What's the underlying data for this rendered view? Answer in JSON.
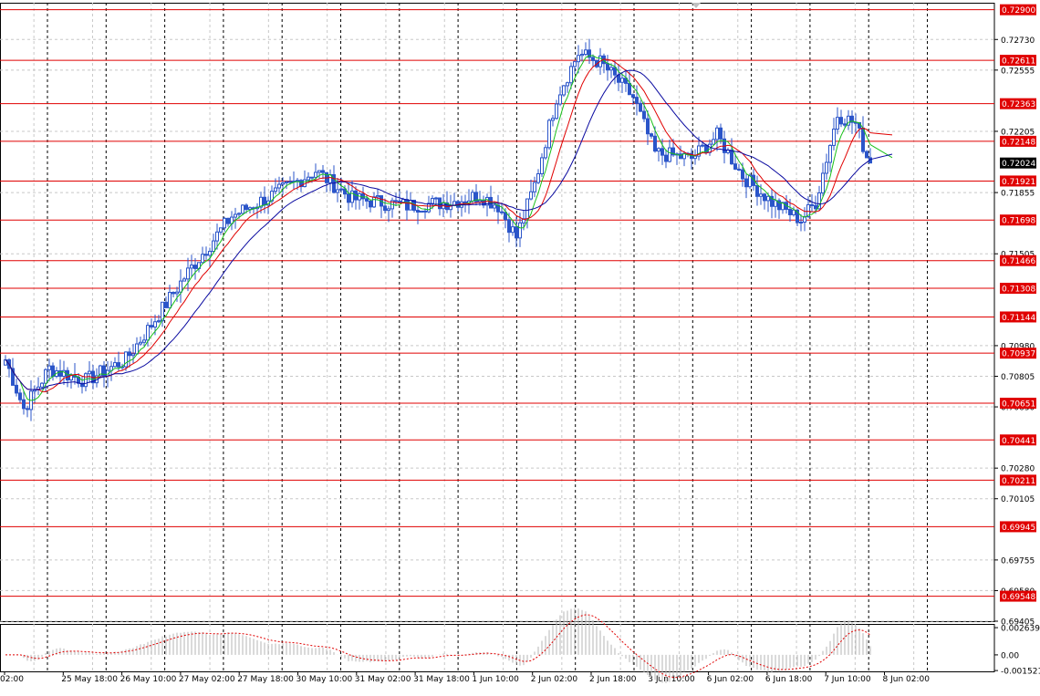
{
  "chart_data": [
    {
      "type": "candlestick",
      "title": "",
      "colors": {
        "candle": "#2b55c9",
        "ma_fast": "#19c019",
        "ma_mid": "#e00000",
        "ma_slow": "#0a0aa0",
        "level_line": "#e00000",
        "current_price_bg": "#000000"
      },
      "y_range": [
        0.69405,
        0.7294
      ],
      "grid": true,
      "price_ticks": [
        "0.72730",
        "0.72555",
        "0.72205",
        "0.71855",
        "0.71505",
        "0.70980",
        "0.70805",
        "0.70630",
        "0.70280",
        "0.70105",
        "0.69755",
        "0.69580",
        "0.69405"
      ],
      "levels": [
        "0.72900",
        "0.72611",
        "0.72363",
        "0.72148",
        "0.71921",
        "0.71698",
        "0.71466",
        "0.71308",
        "0.71144",
        "0.70937",
        "0.70651",
        "0.70441",
        "0.70211",
        "0.69945",
        "0.69548"
      ],
      "current_price": "0.72024",
      "time_labels": [
        "02:00",
        "25 May 18:00",
        "26 May 10:00",
        "27 May 02:00",
        "27 May 18:00",
        "30 May 10:00",
        "31 May 02:00",
        "31 May 18:00",
        "1 Jun 10:00",
        "2 Jun 02:00",
        "2 Jun 18:00",
        "3 Jun 10:00",
        "6 Jun 02:00",
        "6 Jun 18:00",
        "7 Jun 10:00",
        "8 Jun 02:00"
      ],
      "anchors": [
        [
          0,
          0.709
        ],
        [
          5,
          0.7062
        ],
        [
          12,
          0.7085
        ],
        [
          22,
          0.7078
        ],
        [
          33,
          0.709
        ],
        [
          40,
          0.711
        ],
        [
          50,
          0.714
        ],
        [
          62,
          0.7172
        ],
        [
          75,
          0.7186
        ],
        [
          85,
          0.7198
        ],
        [
          95,
          0.7182
        ],
        [
          110,
          0.7178
        ],
        [
          122,
          0.718
        ],
        [
          130,
          0.7184
        ],
        [
          135,
          0.7178
        ],
        [
          140,
          0.716
        ],
        [
          145,
          0.719
        ],
        [
          151,
          0.724
        ],
        [
          157,
          0.7265
        ],
        [
          163,
          0.726
        ],
        [
          172,
          0.724
        ],
        [
          178,
          0.7208
        ],
        [
          188,
          0.7205
        ],
        [
          195,
          0.7218
        ],
        [
          202,
          0.7195
        ],
        [
          210,
          0.718
        ],
        [
          218,
          0.717
        ],
        [
          222,
          0.718
        ],
        [
          228,
          0.723
        ],
        [
          233,
          0.7225
        ],
        [
          237,
          0.72
        ]
      ],
      "ma_periods": [
        5,
        10,
        20
      ]
    },
    {
      "type": "histogram",
      "title": "",
      "ticks": [
        "0.002639",
        "0.00",
        "-0.001521"
      ],
      "range": [
        -0.0016,
        0.003
      ],
      "colors": {
        "bars": "#b4b4b4",
        "signal": "#e00000"
      }
    }
  ]
}
